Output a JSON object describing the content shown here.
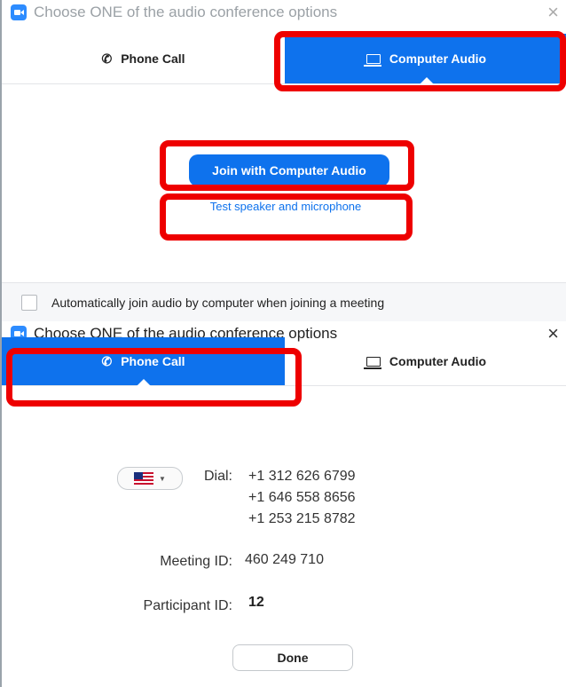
{
  "top_dialog": {
    "title": "Choose ONE of the audio conference options",
    "close": "×",
    "tabs": {
      "phone_call": "Phone Call",
      "computer_audio": "Computer Audio",
      "active": "computer_audio"
    },
    "join_button": "Join with Computer Audio",
    "test_link": "Test speaker and microphone",
    "auto_join_label": "Automatically join audio by computer when joining a meeting"
  },
  "bottom_dialog": {
    "title": "Choose ONE of the audio conference options",
    "close": "×",
    "tabs": {
      "phone_call": "Phone Call",
      "computer_audio": "Computer Audio",
      "active": "phone_call"
    },
    "dial_label": "Dial:",
    "numbers": [
      "+1 312 626 6799",
      "+1 646 558 8656",
      "+1 253 215 8782"
    ],
    "meeting_id_label": "Meeting ID:",
    "meeting_id": "460 249 710",
    "participant_id_label": "Participant ID:",
    "participant_id": "12",
    "done_button": "Done"
  },
  "colors": {
    "accent": "#0e72ed",
    "highlight": "#ee0000"
  }
}
